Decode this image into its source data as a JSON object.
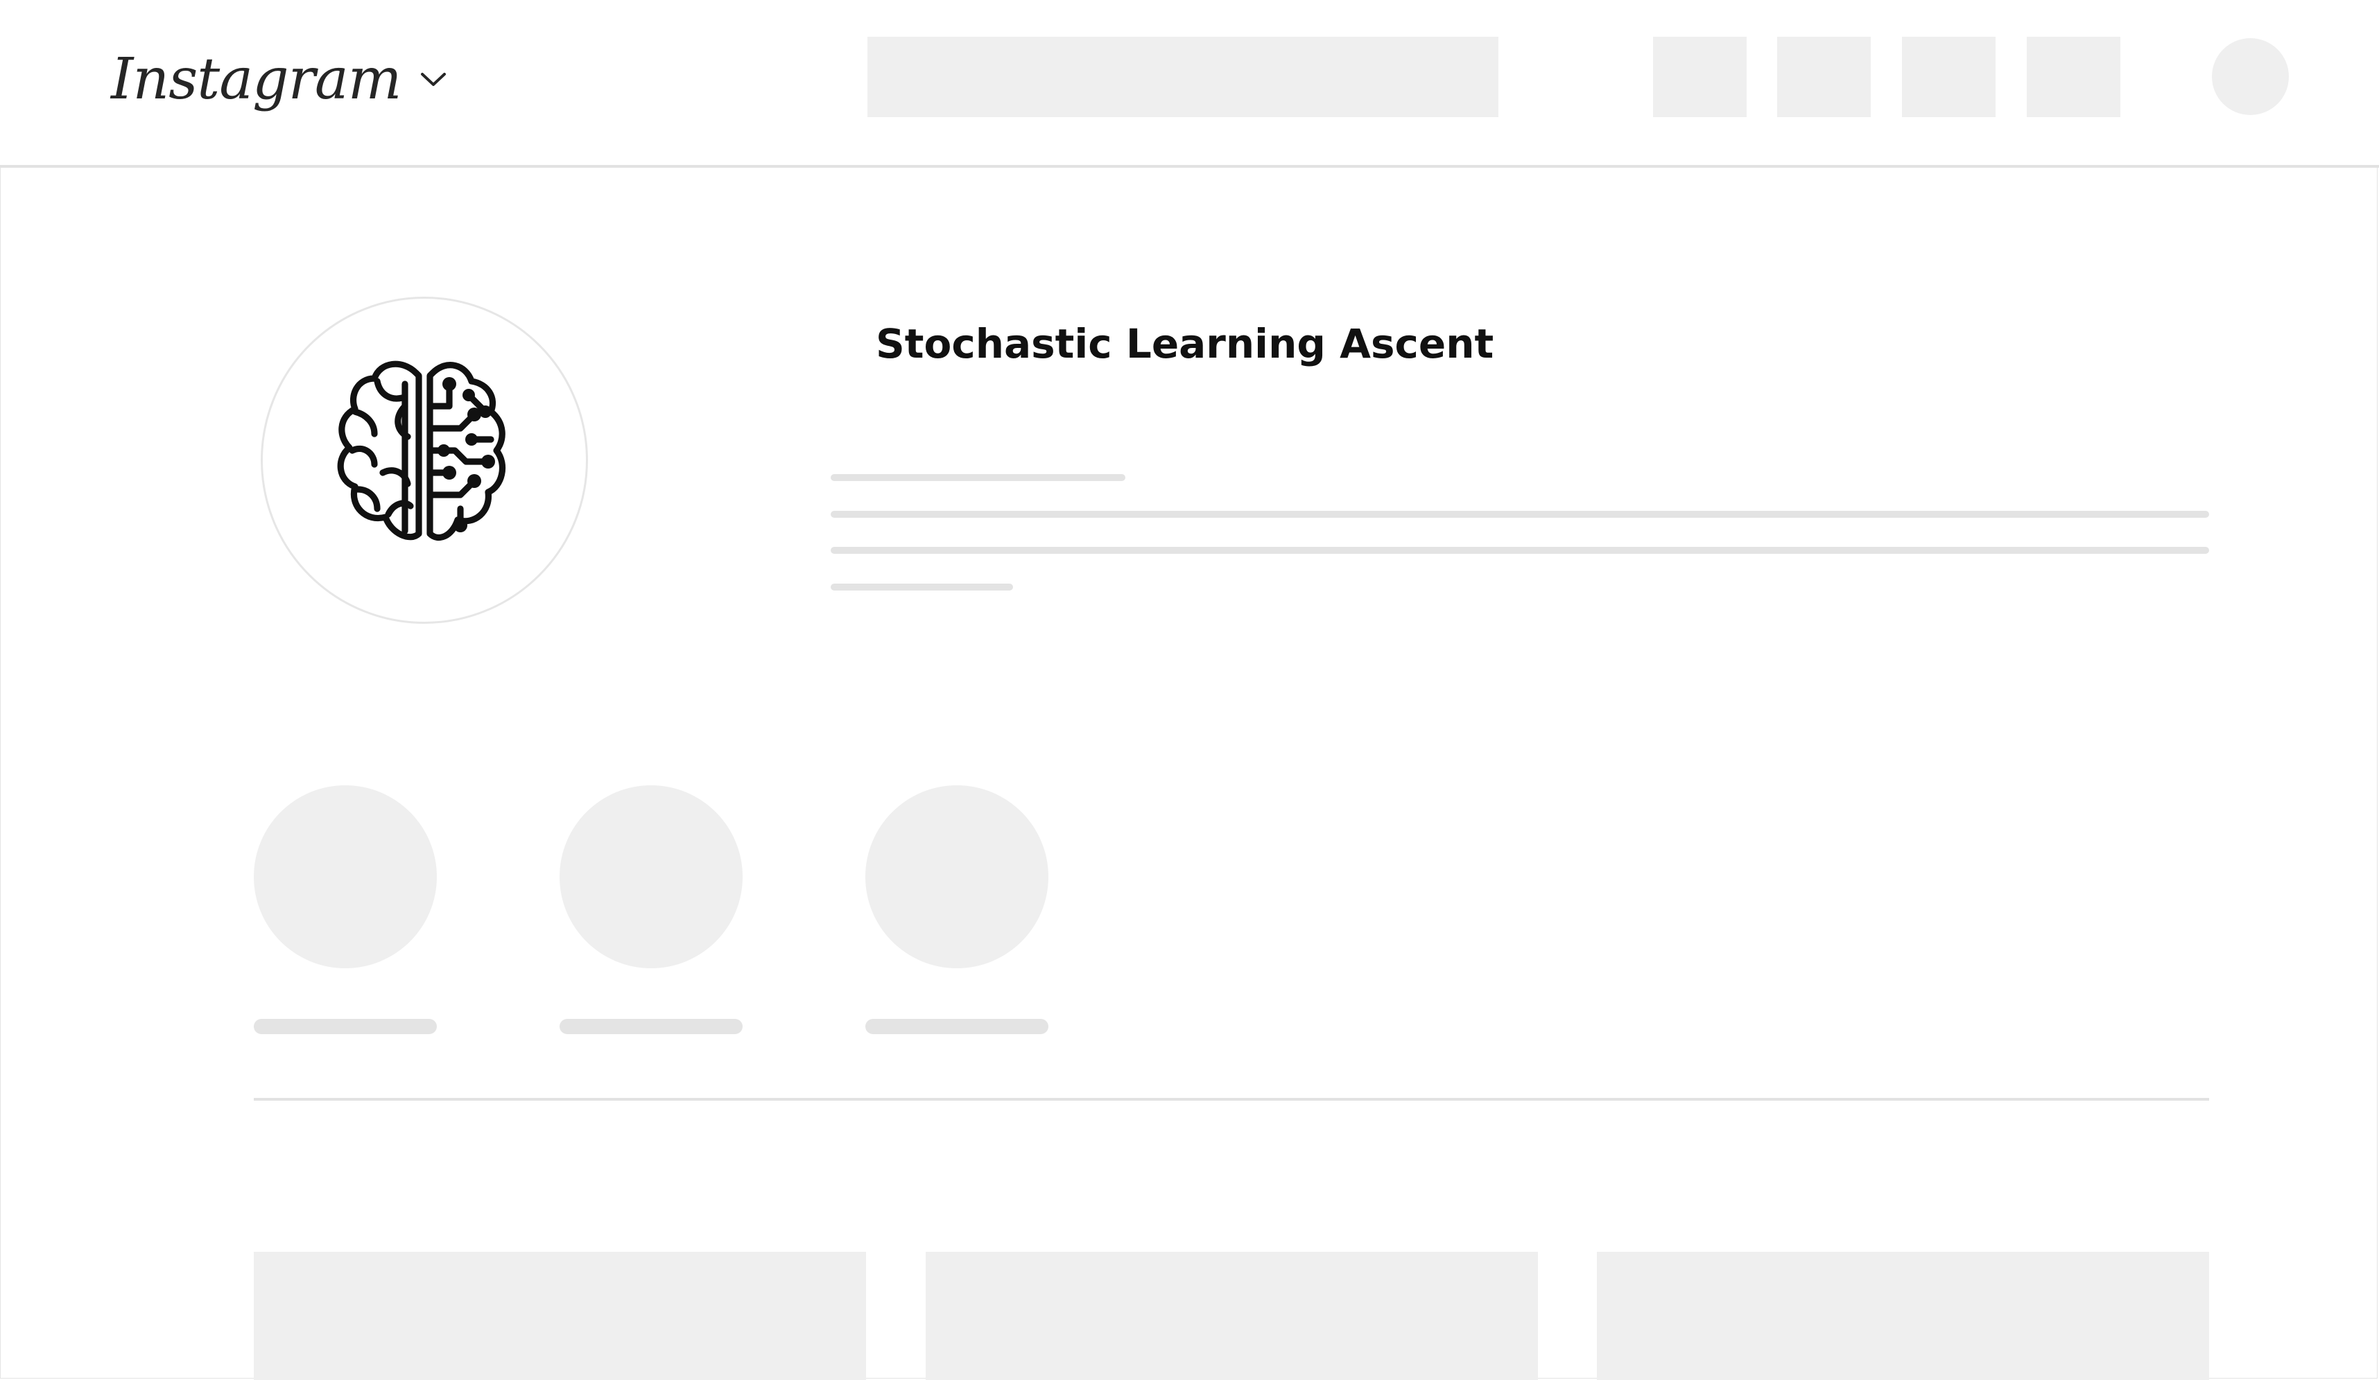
{
  "header": {
    "logo_text": "Instagram",
    "logo_dropdown_icon": "chevron-down-icon",
    "search_placeholder": "",
    "nav_icons": [
      "nav-placeholder",
      "nav-placeholder",
      "nav-placeholder",
      "nav-placeholder"
    ],
    "account_avatar": "avatar-placeholder"
  },
  "profile": {
    "name": "Stochastic Learning Ascent",
    "avatar_icon": "brain-circuit-icon",
    "bio_lines": 4
  },
  "highlights": {
    "count": 3,
    "labels": [
      "",
      "",
      ""
    ]
  },
  "posts": {
    "count": 3
  },
  "colors": {
    "skeleton": "#efefef",
    "skeleton_line": "#e3e3e3",
    "divider": "#e2e2e2",
    "text": "#111111",
    "background": "#ffffff"
  }
}
